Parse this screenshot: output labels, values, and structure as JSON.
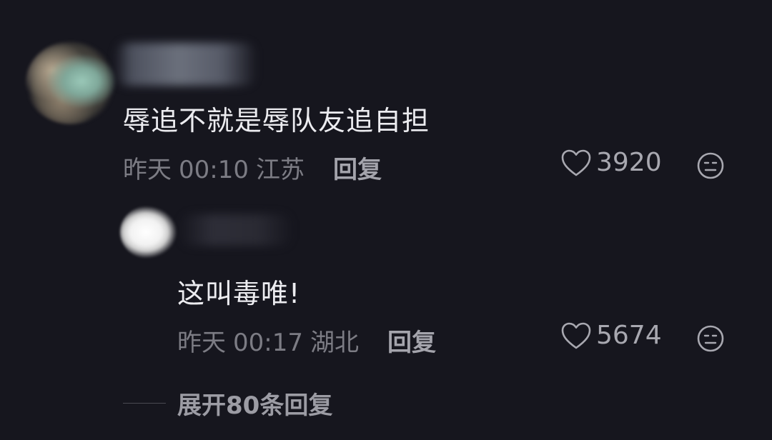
{
  "comments": [
    {
      "text": "辱追不就是辱队友追自担",
      "date": "昨天",
      "time": "00:10",
      "location": "江苏",
      "reply_label": "回复",
      "likes": "3920"
    }
  ],
  "replies": [
    {
      "text": "这叫毒唯!",
      "date": "昨天",
      "time": "00:17",
      "location": "湖北",
      "reply_label": "回复",
      "likes": "5674"
    }
  ],
  "expand": {
    "label": "展开80条回复"
  },
  "icons": {
    "like": "heart-outline-icon",
    "dislike": "neutral-face-icon"
  },
  "colors": {
    "background": "#16161e",
    "primary_text": "#ececf0",
    "secondary_text": "#7c7c84"
  }
}
